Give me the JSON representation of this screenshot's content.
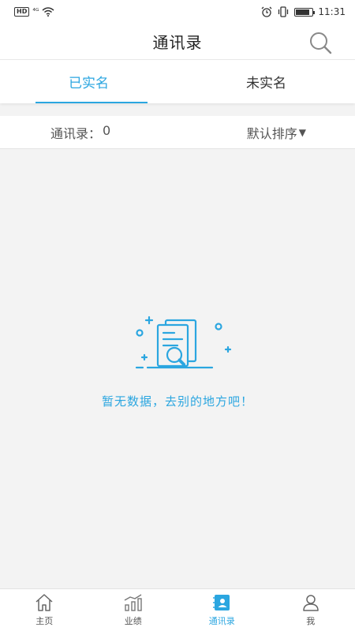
{
  "status_bar": {
    "left_badge": "HD",
    "network": "⁴ᴳ",
    "time": "11:31",
    "battery_level": 0.85
  },
  "header": {
    "title": "通讯录",
    "search_icon": "search-icon"
  },
  "tabs": [
    {
      "label": "已实名",
      "active": true
    },
    {
      "label": "未实名",
      "active": false
    }
  ],
  "list_info": {
    "count_label": "通讯录：",
    "count_value": "0",
    "sort_label": "默认排序",
    "sort_arrow": "▼"
  },
  "empty_state": {
    "message": "暂无数据，去别的地方吧！",
    "icon": "empty-document-search-icon"
  },
  "bottom_nav": [
    {
      "label": "主页",
      "icon": "home-icon",
      "active": false
    },
    {
      "label": "业绩",
      "icon": "chart-icon",
      "active": false
    },
    {
      "label": "通讯录",
      "icon": "contacts-icon",
      "active": true
    },
    {
      "label": "我",
      "icon": "user-icon",
      "active": false
    }
  ],
  "colors": {
    "accent": "#2ba6e0",
    "background": "#f3f3f3",
    "text": "#333333"
  }
}
